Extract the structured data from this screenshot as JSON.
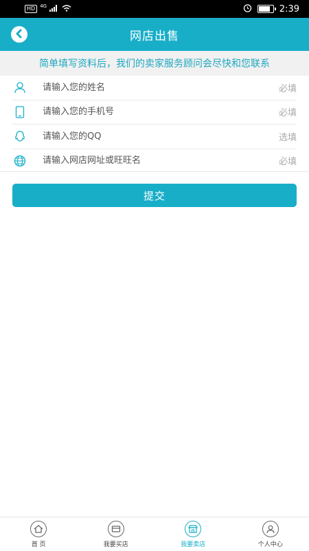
{
  "status_bar": {
    "hd": "HD",
    "network": "4G",
    "time": "2:39",
    "battery_level": 0.8
  },
  "header": {
    "back_icon": "chevron-left-icon",
    "title": "网店出售"
  },
  "notice": "简单填写资料后，我们的卖家服务顾问会尽快和您联系",
  "form": {
    "fields": [
      {
        "icon": "user-icon",
        "placeholder": "请输入您的姓名",
        "requirement": "必填"
      },
      {
        "icon": "phone-icon",
        "placeholder": "请输入您的手机号",
        "requirement": "必填"
      },
      {
        "icon": "qq-icon",
        "placeholder": "请输入您的QQ",
        "requirement": "选填"
      },
      {
        "icon": "globe-icon",
        "placeholder": "请输入网店网址或旺旺名",
        "requirement": "必填"
      }
    ],
    "submit_label": "提交"
  },
  "tabbar": {
    "items": [
      {
        "icon": "home-icon",
        "label": "首 页",
        "active": false
      },
      {
        "icon": "shop-icon",
        "label": "我要买店",
        "active": false
      },
      {
        "icon": "store-icon",
        "label": "我要卖店",
        "active": true
      },
      {
        "icon": "user-icon",
        "label": "个人中心",
        "active": false
      }
    ]
  },
  "colors": {
    "accent": "#18aec8",
    "notice_text": "#1fa7c0",
    "notice_bg": "#f1f1f1"
  }
}
